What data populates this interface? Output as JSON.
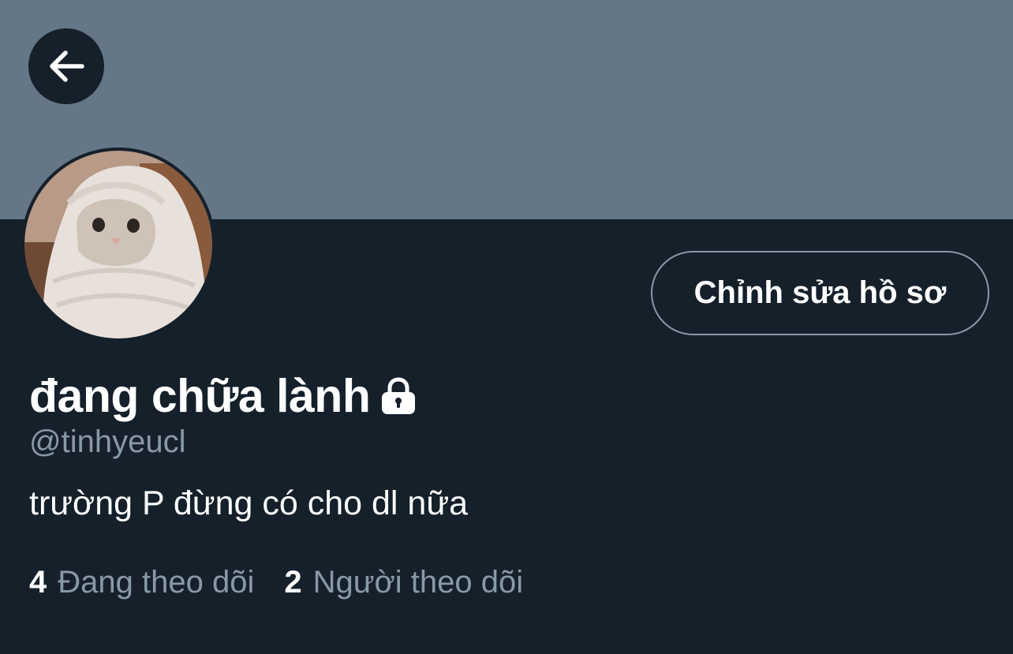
{
  "profile": {
    "display_name": "đang chữa lành",
    "handle": "@tinhyeucl",
    "bio": "trường P đừng có cho dl nữa",
    "protected": true
  },
  "actions": {
    "edit_profile_label": "Chỉnh sửa hồ sơ"
  },
  "stats": {
    "following_count": "4",
    "following_label": "Đang theo dõi",
    "followers_count": "2",
    "followers_label": "Người theo dõi"
  },
  "icons": {
    "back": "arrow-left-icon",
    "lock": "lock-icon"
  },
  "colors": {
    "background": "#15202b",
    "banner": "#657786",
    "secondary_text": "#8899a6",
    "primary_text": "#ffffff"
  }
}
